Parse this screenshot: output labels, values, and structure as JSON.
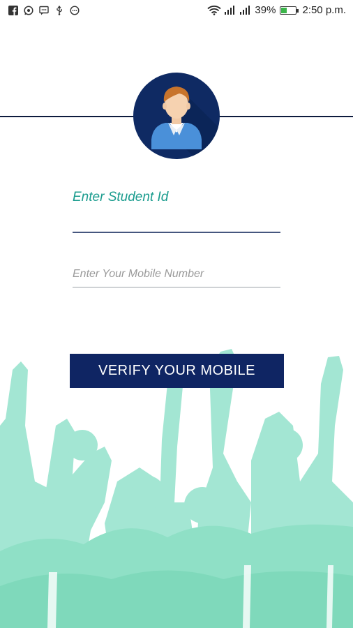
{
  "status_bar": {
    "notification_icons": [
      "facebook-icon",
      "whatsapp-icon",
      "message-icon",
      "usb-icon",
      "sync-icon"
    ],
    "battery_percent": "39%",
    "battery_level": 0.39,
    "time": "2:50 p.m."
  },
  "form": {
    "student_id_label": "Enter Student Id",
    "mobile_placeholder": "Enter Your Mobile Number"
  },
  "buttons": {
    "verify_label": "VERIFY YOUR MOBILE"
  },
  "colors": {
    "primary": "#0f2563",
    "accent_teal": "#1a9c8e",
    "crowd_mint": "#8fe0c6"
  }
}
